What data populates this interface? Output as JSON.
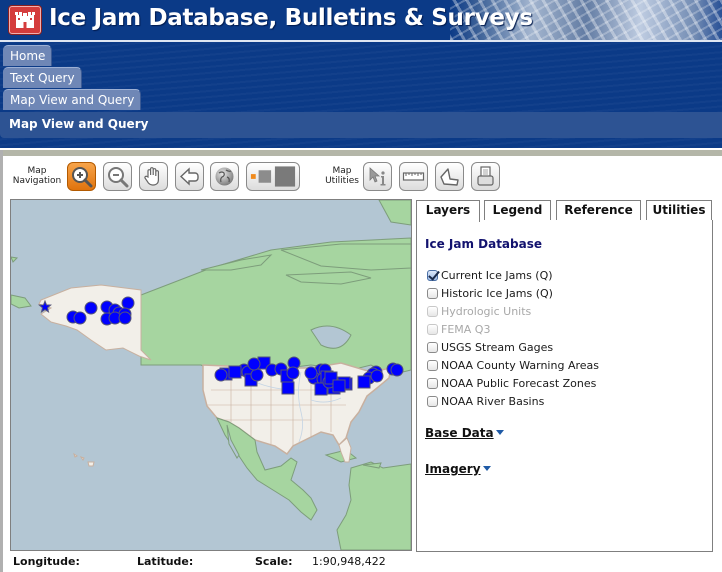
{
  "header": {
    "title": "Ice Jam Database, Bulletins & Surveys",
    "logo_icon": "castle-icon"
  },
  "nav": {
    "tabs": [
      {
        "label": "Home"
      },
      {
        "label": "Text Query"
      },
      {
        "label": "Map View and Query"
      }
    ],
    "active_section": "Map View and Query"
  },
  "toolbar": {
    "navigation_label": "Map Navigation",
    "utilities_label": "Map Utilities",
    "navigation_tools": [
      {
        "name": "zoom-in",
        "icon": "zoom-in-icon",
        "active": true
      },
      {
        "name": "zoom-out",
        "icon": "zoom-out-icon",
        "active": false
      },
      {
        "name": "pan",
        "icon": "hand-icon",
        "active": false
      },
      {
        "name": "previous-extent",
        "icon": "back-arrow-icon",
        "active": false
      },
      {
        "name": "full-extent",
        "icon": "globe-icon",
        "active": false
      },
      {
        "name": "zoom-scale",
        "icon": "scale-squares-icon",
        "active": false
      }
    ],
    "utility_tools": [
      {
        "name": "identify",
        "icon": "identify-icon"
      },
      {
        "name": "measure",
        "icon": "ruler-icon"
      },
      {
        "name": "area",
        "icon": "polygon-icon"
      },
      {
        "name": "print",
        "icon": "printer-icon"
      }
    ]
  },
  "map": {
    "colors": {
      "water": "#b3c6d3",
      "land_other": "#a6d5a0",
      "land_us": "#f2efe9",
      "marker": "#0000ff"
    },
    "marker_count_visible": 48
  },
  "status": {
    "longitude_label": "Longitude:",
    "longitude_value": "",
    "latitude_label": "Latitude:",
    "latitude_value": "",
    "scale_label": "Scale:",
    "scale_value": "1:90,948,422"
  },
  "panel": {
    "tabs": [
      {
        "label": "Layers",
        "active": true
      },
      {
        "label": "Legend",
        "active": false
      },
      {
        "label": "Reference",
        "active": false
      },
      {
        "label": "Utilities",
        "active": false
      }
    ],
    "title": "Ice Jam Database",
    "layers": [
      {
        "label": "Current Ice Jams (Q)",
        "checked": true,
        "enabled": true
      },
      {
        "label": "Historic Ice Jams (Q)",
        "checked": false,
        "enabled": true
      },
      {
        "label": "Hydrologic Units",
        "checked": false,
        "enabled": false
      },
      {
        "label": "FEMA Q3",
        "checked": false,
        "enabled": false
      },
      {
        "label": "USGS Stream Gages",
        "checked": false,
        "enabled": true
      },
      {
        "label": "NOAA County Warning Areas",
        "checked": false,
        "enabled": true
      },
      {
        "label": "NOAA Public Forecast Zones",
        "checked": false,
        "enabled": true
      },
      {
        "label": "NOAA River Basins",
        "checked": false,
        "enabled": true
      }
    ],
    "sections": [
      {
        "label": "Base Data"
      },
      {
        "label": "Imagery"
      }
    ]
  }
}
